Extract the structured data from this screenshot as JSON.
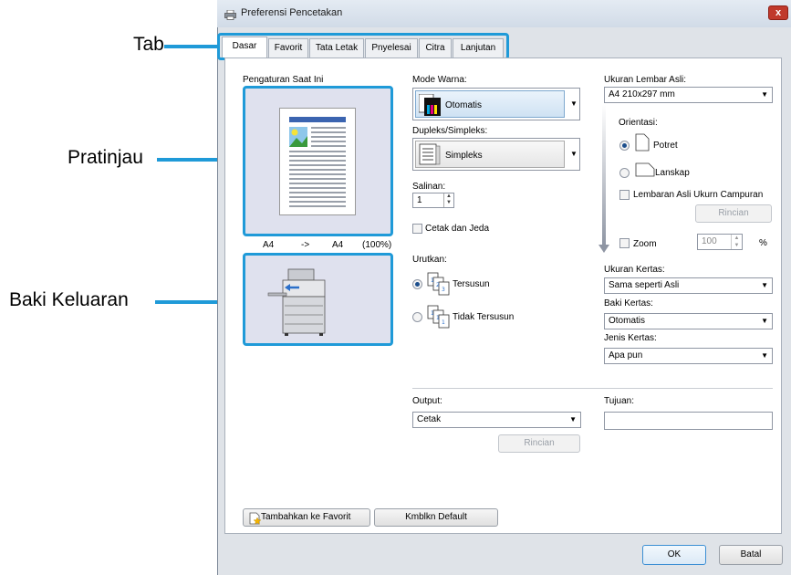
{
  "callouts": {
    "tab": "Tab",
    "preview": "Pratinjau",
    "output_tray": "Baki Keluaran"
  },
  "window": {
    "title": "Preferensi Pencetakan",
    "close": "x"
  },
  "tabs": [
    "Dasar",
    "Favorit",
    "Tata Letak",
    "Pnyelesai",
    "Citra",
    "Lanjutan"
  ],
  "left": {
    "current_settings_label": "Pengaturan Saat Ini",
    "preview_source": "A4",
    "preview_arrow": "->",
    "preview_dest": "A4",
    "preview_scale": "(100%)"
  },
  "middle": {
    "color_mode_label": "Mode Warna:",
    "color_mode_value": "Otomatis",
    "duplex_label": "Dupleks/Simpleks:",
    "duplex_value": "Simpleks",
    "copies_label": "Salinan:",
    "copies_value": "1",
    "print_pause_label": "Cetak dan Jeda",
    "sort_label": "Urutkan:",
    "collated_label": "Tersusun",
    "uncollated_label": "Tidak Tersusun"
  },
  "right": {
    "original_size_label": "Ukuran Lembar Asli:",
    "original_size_value": "A4 210x297 mm",
    "orientation_label": "Orientasi:",
    "portrait_label": "Potret",
    "landscape_label": "Lanskap",
    "mixed_size_label": "Lembaran Asli Ukurn Campuran",
    "details_button": "Rincian",
    "zoom_label": "Zoom",
    "zoom_value": "100",
    "zoom_unit": "%",
    "paper_size_label": "Ukuran Kertas:",
    "paper_size_value": "Sama seperti Asli",
    "paper_tray_label": "Baki Kertas:",
    "paper_tray_value": "Otomatis",
    "paper_type_label": "Jenis Kertas:",
    "paper_type_value": "Apa pun"
  },
  "bottom": {
    "output_label": "Output:",
    "output_value": "Cetak",
    "output_details_button": "Rincian",
    "destination_label": "Tujuan:",
    "destination_value": "",
    "add_favorite_button": "Tambahkan ke Favorit",
    "restore_default_button": "Kmblkn Default",
    "ok_button": "OK",
    "cancel_button": "Batal"
  },
  "colors": {
    "callout_accent": "#1f9ad8",
    "preview_bg": "#dfe1ee",
    "title_bar": "#d1dbe7"
  }
}
